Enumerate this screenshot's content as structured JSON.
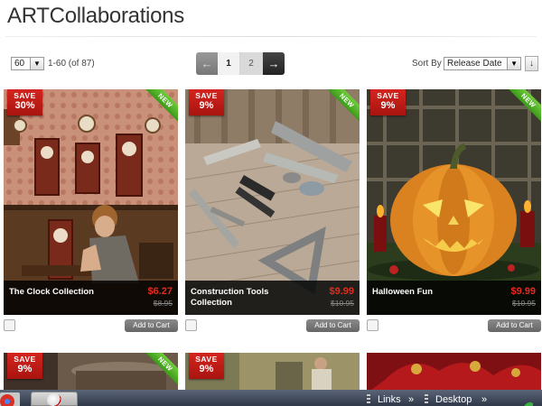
{
  "header": {
    "title": "ARTCollaborations"
  },
  "toolbar": {
    "per_page": "60",
    "range_text": "1-60 (of 87)",
    "pager": {
      "prev": "←",
      "pages": [
        "1",
        "2"
      ],
      "next": "→"
    },
    "sort_label": "Sort By",
    "sort_value": "Release Date",
    "sort_direction": "↓"
  },
  "products": [
    {
      "name": "The Clock Collection",
      "price": "$6.27",
      "old_price": "$8.95",
      "save_label": "SAVE",
      "save_pct": "30%",
      "badge": "NEW",
      "add_to_cart": "Add to Cart"
    },
    {
      "name": "Construction Tools Collection",
      "price": "$9.99",
      "old_price": "$10.95",
      "save_label": "SAVE",
      "save_pct": "9%",
      "badge": "NEW",
      "add_to_cart": "Add to Cart"
    },
    {
      "name": "Halloween Fun",
      "price": "$9.99",
      "old_price": "$10.95",
      "save_label": "SAVE",
      "save_pct": "9%",
      "badge": "NEW",
      "add_to_cart": "Add to Cart"
    },
    {
      "save_label": "SAVE",
      "save_pct": "9%",
      "badge": "NEW"
    },
    {
      "save_label": "SAVE",
      "save_pct": "9%"
    },
    {}
  ],
  "taskbar": {
    "links": "Links",
    "desktop": "Desktop",
    "chevron": "»"
  },
  "colors": {
    "sale_red": "#e52b1e",
    "new_green": "#4caf28",
    "caption_bg": "#111111"
  }
}
